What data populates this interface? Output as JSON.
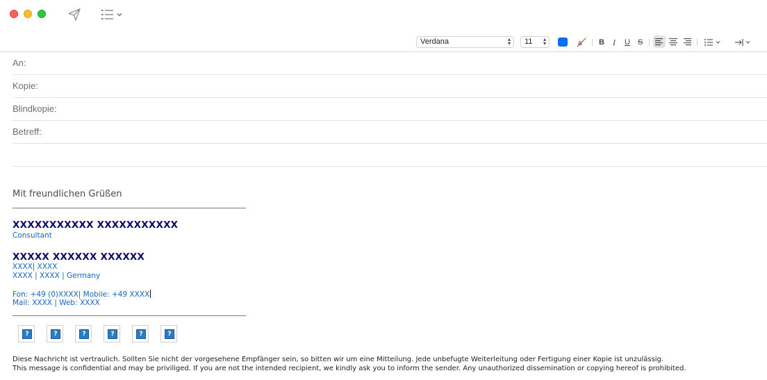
{
  "toolbar": {
    "send_icon": "paper-plane-icon",
    "header_fields_icon": "list-icon"
  },
  "format_bar": {
    "font_family": "Verdana",
    "font_size": "11",
    "text_color": "#0a6cf5",
    "bold_label": "B",
    "italic_label": "I",
    "underline_label": "U",
    "strike_label": "S",
    "alignment_selected": "left"
  },
  "header": {
    "to_label": "An:",
    "cc_label": "Kopie:",
    "bcc_label": "Blindkopie:",
    "subject_label": "Betreff:"
  },
  "body": {
    "greeting": "Mit freundlichen Grüßen",
    "signature": {
      "name": "XXXXXXXXXXX XXXXXXXXXXX",
      "role": "Consultant",
      "company": "XXXXX XXXXXX XXXXXX",
      "address_line1": "XXXX| XXXX",
      "address_line2": "XXXX | XXXX | Germany",
      "phone_line": "Fon: +49 (0)XXXX| Mobile: +49 XXXX",
      "mail_line": "Mail: XXXX | Web: XXXX",
      "social_icons": [
        "missing-image-icon",
        "missing-image-icon",
        "missing-image-icon",
        "missing-image-icon",
        "missing-image-icon",
        "missing-image-icon"
      ]
    },
    "disclaimer_de": "Diese Nachricht ist vertraulich. Sollten Sie nicht der vorgesehene Empfänger sein, so bitten wir um eine Mitteilung. Jede unbefugte Weiterleitung oder Fertigung einer Kopie ist unzulässig.",
    "disclaimer_en": "This message is confidential and may be priviliged. If you are not the intended recipient, we kindly ask you to inform the sender. Any unauthorized dissemination or copying hereof is prohibited."
  }
}
